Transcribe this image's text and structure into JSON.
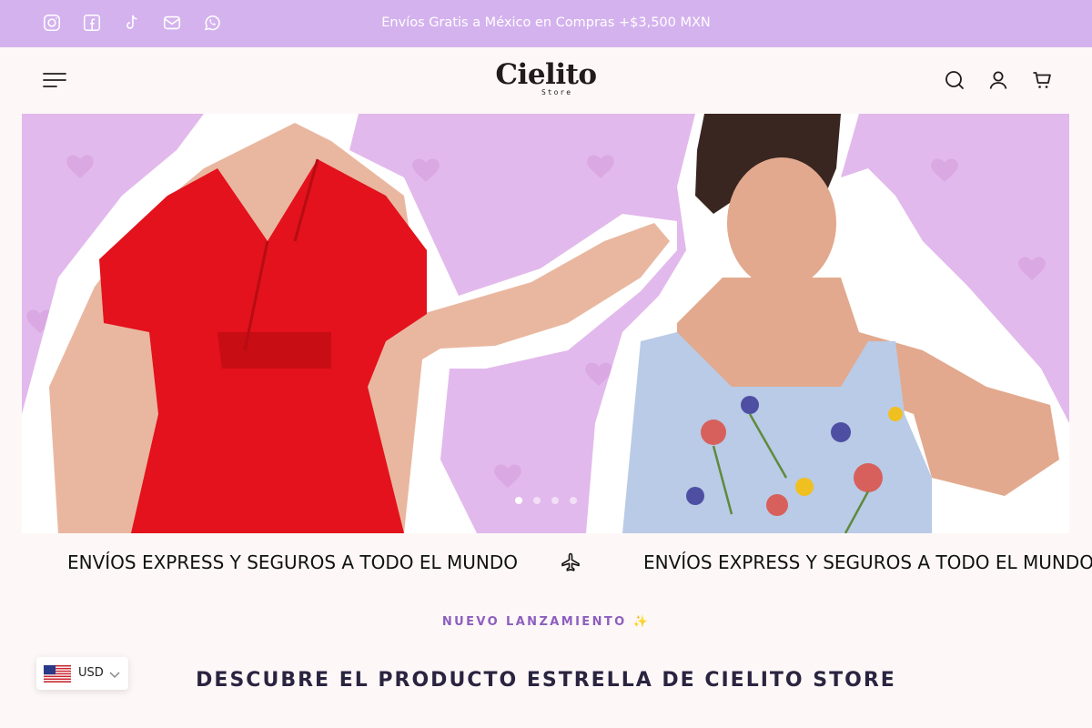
{
  "topbar": {
    "announcement": "Envíos Gratis a México en Compras +$3,500 MXN",
    "social_icons": [
      "instagram-icon",
      "facebook-icon",
      "tiktok-icon",
      "email-icon",
      "whatsapp-icon"
    ],
    "background": "#d4b2ee"
  },
  "header": {
    "logo_main": "Cielito",
    "logo_sub": "Store",
    "icons": [
      "menu-icon",
      "search-icon",
      "account-icon",
      "cart-icon"
    ]
  },
  "hero": {
    "background": "#e2b9ec",
    "slide_count": 4,
    "active_slide": 1
  },
  "marquee": {
    "text": "ENVÍOS EXPRESS Y SEGUROS A TODO EL MUNDO",
    "icon": "airplane-icon"
  },
  "section": {
    "eyebrow": "NUEVO LANZAMIENTO ✨",
    "title": "DESCUBRE EL PRODUCTO ESTRELLA DE CIELITO STORE"
  },
  "currency": {
    "code": "USD",
    "flag": "us-flag-icon"
  },
  "colors": {
    "accent": "#8d5fbf",
    "page_background": "#fdf8f7",
    "text_dark": "#2a2440"
  }
}
